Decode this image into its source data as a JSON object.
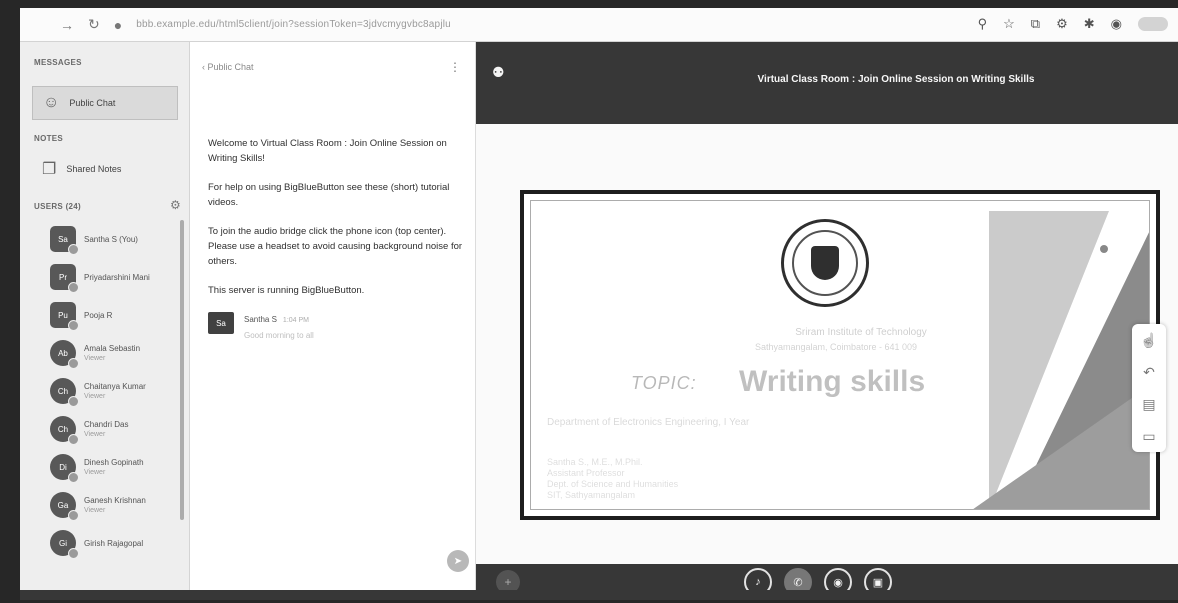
{
  "browser": {
    "url": "bbb.example.edu/html5client/join?sessionToken=3jdvcmygvbc8apjlu",
    "icons": [
      "star-icon",
      "extension-icon",
      "settings-icon",
      "profile-icon"
    ]
  },
  "sidebar": {
    "messages_head": "MESSAGES",
    "public_chat": "Public Chat",
    "notes_head": "NOTES",
    "shared_notes": "Shared Notes",
    "users_head": "USERS (24)",
    "users": [
      {
        "initials": "Sa",
        "name": "Santha S (You)",
        "sub": ""
      },
      {
        "initials": "Pr",
        "name": "Priyadarshini Mani",
        "sub": ""
      },
      {
        "initials": "Pu",
        "name": "Pooja R",
        "sub": ""
      },
      {
        "initials": "Ab",
        "name": "Amala Sebastin",
        "sub": "Viewer"
      },
      {
        "initials": "Ch",
        "name": "Chaitanya Kumar",
        "sub": "Viewer"
      },
      {
        "initials": "Ch",
        "name": "Chandri Das",
        "sub": "Viewer"
      },
      {
        "initials": "Di",
        "name": "Dinesh Gopinath",
        "sub": "Viewer"
      },
      {
        "initials": "Ga",
        "name": "Ganesh Krishnan",
        "sub": "Viewer"
      },
      {
        "initials": "Gi",
        "name": "Girish Rajagopal",
        "sub": ""
      }
    ]
  },
  "chat": {
    "back_label": "‹ Public Chat",
    "welcome": "Welcome to Virtual Class Room : Join Online Session on Writing Skills!",
    "help": "For help on using BigBlueButton see these (short) tutorial videos.",
    "audio": "To join the audio bridge click the phone icon (top center). Please use a headset to avoid causing background noise for others.",
    "server": "This server is running BigBlueButton.",
    "msg_sender": "Santha S",
    "msg_time": "1:04 PM",
    "msg_text": "Good morning to all"
  },
  "stage": {
    "title": "Virtual Class Room : Join Online Session on Writing Skills",
    "slide": {
      "institute": "Sriram Institute of Technology",
      "address": "Sathyamangalam, Coimbatore - 641 009",
      "topic": "TOPIC:",
      "heading": "Writing skills",
      "line1": "Department of Electronics Engineering, I Year",
      "line2a": "Santha S., M.E., M.Phil.",
      "line2b": "Assistant Professor",
      "line2c": "Dept. of Science and Humanities",
      "line2d": "SIT, Sathyamangalam"
    }
  },
  "colors": {
    "header_bg": "#3a3a3a",
    "sidebar_bg": "#e9e9e9",
    "chat_bg": "#fafafa"
  }
}
